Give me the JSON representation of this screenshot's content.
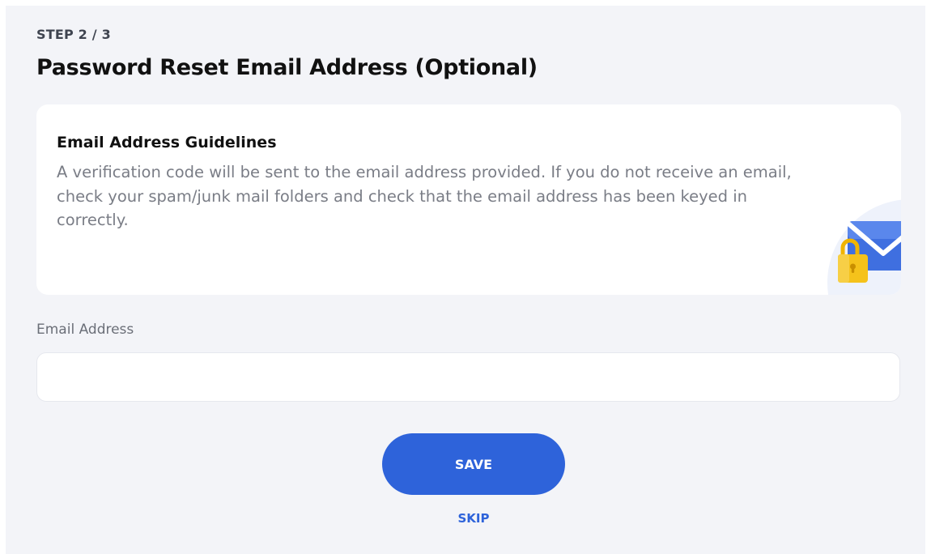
{
  "header": {
    "step": "STEP 2 / 3",
    "title": "Password Reset Email Address (Optional)"
  },
  "guidelines": {
    "title": "Email Address Guidelines",
    "body": "A verification code will be sent to the email address provided. If you do not receive an email, check your spam/junk mail folders and check that the email address has been keyed in correctly.",
    "illustration": "envelope-with-padlock-icon"
  },
  "form": {
    "email_label": "Email Address",
    "email_value": "",
    "email_placeholder": ""
  },
  "actions": {
    "save_label": "SAVE",
    "skip_label": "SKIP"
  },
  "colors": {
    "accent": "#2e63da",
    "background": "#f3f4f8",
    "envelope": "#4a7be6",
    "padlock": "#f5c21b"
  }
}
